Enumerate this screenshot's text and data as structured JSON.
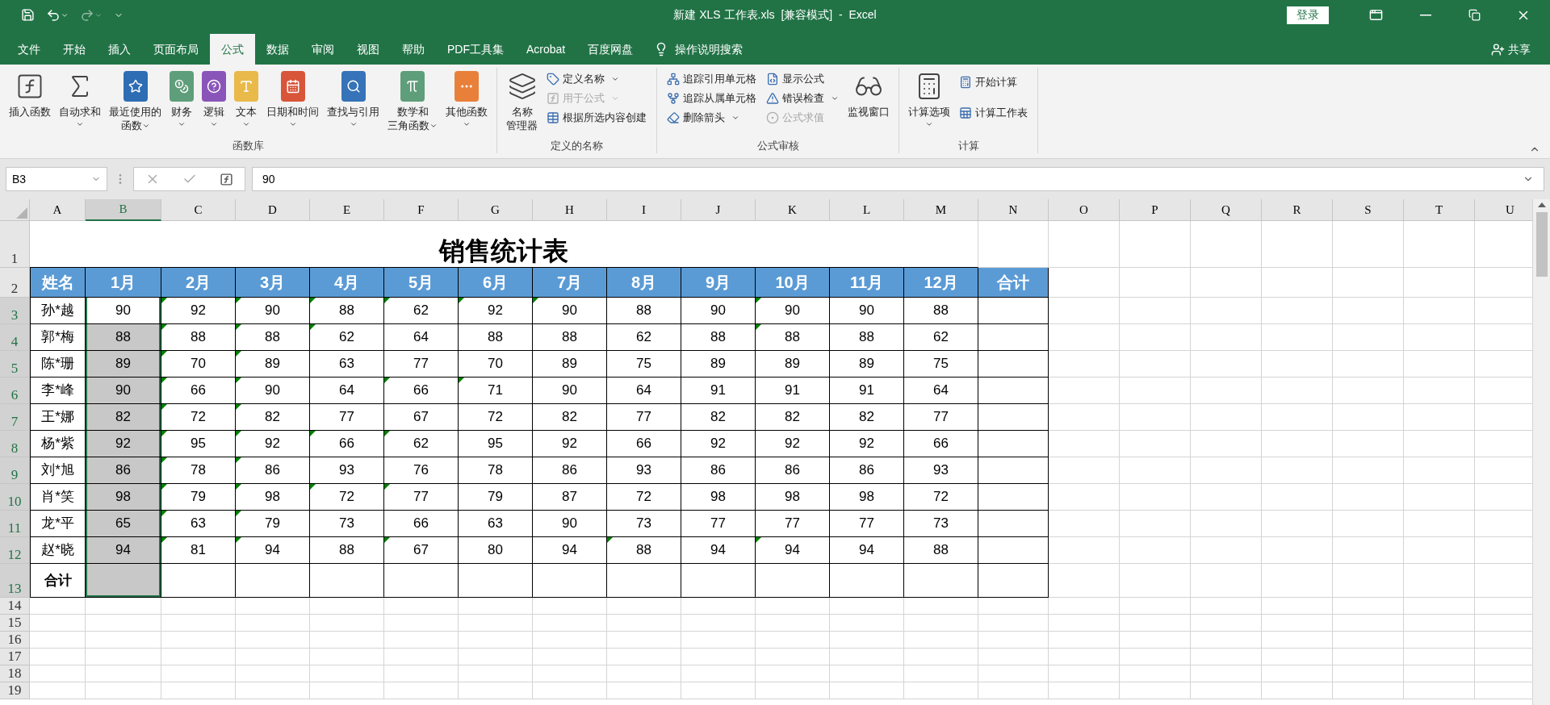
{
  "title_bar": {
    "title": "新建 XLS 工作表.xls  [兼容模式]  -  Excel",
    "sign_in": "登录"
  },
  "tabs": [
    {
      "label": "文件",
      "selected": false
    },
    {
      "label": "开始",
      "selected": false
    },
    {
      "label": "插入",
      "selected": false
    },
    {
      "label": "页面布局",
      "selected": false
    },
    {
      "label": "公式",
      "selected": true
    },
    {
      "label": "数据",
      "selected": false
    },
    {
      "label": "审阅",
      "selected": false
    },
    {
      "label": "视图",
      "selected": false
    },
    {
      "label": "帮助",
      "selected": false
    },
    {
      "label": "PDF工具集",
      "selected": false
    },
    {
      "label": "Acrobat",
      "selected": false
    },
    {
      "label": "百度网盘",
      "selected": false
    }
  ],
  "tell_me": "操作说明搜索",
  "share": "共享",
  "ribbon": [
    {
      "name": "函数库",
      "items": [
        {
          "kind": "large",
          "lines": [
            "插入函数"
          ],
          "dropdown": false,
          "disabled": false
        },
        {
          "kind": "large",
          "lines": [
            "自动求和"
          ],
          "dropdown": true,
          "disabled": false
        },
        {
          "kind": "large",
          "lines": [
            "最近使用的",
            "函数"
          ],
          "dropdown": true,
          "disabled": false
        },
        {
          "kind": "large",
          "lines": [
            "财务"
          ],
          "dropdown": true,
          "disabled": false
        },
        {
          "kind": "large",
          "lines": [
            "逻辑"
          ],
          "dropdown": true,
          "disabled": false
        },
        {
          "kind": "large",
          "lines": [
            "文本"
          ],
          "dropdown": true,
          "disabled": false
        },
        {
          "kind": "large",
          "lines": [
            "日期和时间"
          ],
          "dropdown": true,
          "disabled": false
        },
        {
          "kind": "large",
          "lines": [
            "查找与引用"
          ],
          "dropdown": true,
          "disabled": false
        },
        {
          "kind": "large",
          "lines": [
            "数学和",
            "三角函数"
          ],
          "dropdown": true,
          "disabled": false
        },
        {
          "kind": "large",
          "lines": [
            "其他函数"
          ],
          "dropdown": true,
          "disabled": false
        }
      ]
    },
    {
      "name": "定义的名称",
      "items": [
        {
          "kind": "large",
          "lines": [
            "名称",
            "管理器"
          ],
          "dropdown": false,
          "disabled": false
        },
        {
          "kind": "small",
          "lines": [
            "定义名称"
          ],
          "dropdown": true,
          "disabled": false
        },
        {
          "kind": "small",
          "lines": [
            "用于公式"
          ],
          "dropdown": true,
          "disabled": true
        },
        {
          "kind": "small",
          "lines": [
            "根据所选内容创建"
          ],
          "dropdown": false,
          "disabled": false
        }
      ]
    },
    {
      "name": "公式审核",
      "items": [
        {
          "kind": "small",
          "lines": [
            "追踪引用单元格"
          ],
          "dropdown": false,
          "disabled": false
        },
        {
          "kind": "small",
          "lines": [
            "追踪从属单元格"
          ],
          "dropdown": false,
          "disabled": false
        },
        {
          "kind": "small",
          "lines": [
            "删除箭头"
          ],
          "dropdown": true,
          "disabled": false
        },
        {
          "kind": "small",
          "lines": [
            "显示公式"
          ],
          "dropdown": false,
          "disabled": false
        },
        {
          "kind": "small",
          "lines": [
            "错误检查"
          ],
          "dropdown": true,
          "disabled": false
        },
        {
          "kind": "small",
          "lines": [
            "公式求值"
          ],
          "dropdown": false,
          "disabled": true
        },
        {
          "kind": "large",
          "lines": [
            "监视窗口"
          ],
          "dropdown": false,
          "disabled": false
        }
      ]
    },
    {
      "name": "计算",
      "items": [
        {
          "kind": "large",
          "lines": [
            "计算选项"
          ],
          "dropdown": true,
          "disabled": false
        },
        {
          "kind": "small",
          "lines": [
            "开始计算"
          ],
          "dropdown": false,
          "disabled": false
        },
        {
          "kind": "small",
          "lines": [
            "计算工作表"
          ],
          "dropdown": false,
          "disabled": false
        }
      ]
    }
  ],
  "name_box": "B3",
  "formula": "90",
  "sheet": {
    "columns": [
      {
        "label": "A",
        "selected": false
      },
      {
        "label": "B",
        "selected": true
      },
      {
        "label": "C",
        "selected": false
      },
      {
        "label": "D",
        "selected": false
      },
      {
        "label": "E",
        "selected": false
      },
      {
        "label": "F",
        "selected": false
      },
      {
        "label": "G",
        "selected": false
      },
      {
        "label": "H",
        "selected": false
      },
      {
        "label": "I",
        "selected": false
      },
      {
        "label": "J",
        "selected": false
      },
      {
        "label": "K",
        "selected": false
      },
      {
        "label": "L",
        "selected": false
      },
      {
        "label": "M",
        "selected": false
      },
      {
        "label": "N",
        "selected": false
      },
      {
        "label": "O",
        "selected": false
      },
      {
        "label": "P",
        "selected": false
      },
      {
        "label": "Q",
        "selected": false
      },
      {
        "label": "R",
        "selected": false
      },
      {
        "label": "S",
        "selected": false
      },
      {
        "label": "T",
        "selected": false
      },
      {
        "label": "U",
        "selected": false
      }
    ],
    "title_row": {
      "num": "1",
      "title": "销售统计表"
    },
    "header_row": {
      "num": "2",
      "cells": [
        "姓名",
        "1月",
        "2月",
        "3月",
        "4月",
        "5月",
        "6月",
        "7月",
        "8月",
        "9月",
        "10月",
        "11月",
        "12月",
        "合计"
      ]
    },
    "rows": [
      {
        "num": "3",
        "selected": true,
        "active": true,
        "cells": [
          "孙*越",
          "90",
          "92",
          "90",
          "88",
          "62",
          "92",
          "90",
          "88",
          "90",
          "90",
          "90",
          "88"
        ],
        "flags": [
          false,
          true,
          true,
          true,
          true,
          true,
          true,
          false,
          false,
          true,
          false,
          false
        ]
      },
      {
        "num": "4",
        "selected": true,
        "active": false,
        "cells": [
          "郭*梅",
          "88",
          "88",
          "88",
          "62",
          "64",
          "88",
          "88",
          "62",
          "88",
          "88",
          "88",
          "62"
        ],
        "flags": [
          false,
          true,
          true,
          true,
          false,
          false,
          false,
          false,
          false,
          true,
          false,
          false
        ]
      },
      {
        "num": "5",
        "selected": true,
        "active": false,
        "cells": [
          "陈*珊",
          "89",
          "70",
          "89",
          "63",
          "77",
          "70",
          "89",
          "75",
          "89",
          "89",
          "89",
          "75"
        ],
        "flags": [
          false,
          true,
          true,
          false,
          false,
          false,
          false,
          false,
          false,
          false,
          false,
          false
        ]
      },
      {
        "num": "6",
        "selected": true,
        "active": false,
        "cells": [
          "李*峰",
          "90",
          "66",
          "90",
          "64",
          "66",
          "71",
          "90",
          "64",
          "91",
          "91",
          "91",
          "64"
        ],
        "flags": [
          false,
          true,
          true,
          false,
          true,
          true,
          false,
          false,
          false,
          false,
          false,
          false
        ]
      },
      {
        "num": "7",
        "selected": true,
        "active": false,
        "cells": [
          "王*娜",
          "82",
          "72",
          "82",
          "77",
          "67",
          "72",
          "82",
          "77",
          "82",
          "82",
          "82",
          "77"
        ],
        "flags": [
          false,
          true,
          true,
          false,
          false,
          false,
          false,
          false,
          false,
          false,
          false,
          false
        ]
      },
      {
        "num": "8",
        "selected": true,
        "active": false,
        "cells": [
          "杨*紫",
          "92",
          "95",
          "92",
          "66",
          "62",
          "95",
          "92",
          "66",
          "92",
          "92",
          "92",
          "66"
        ],
        "flags": [
          false,
          true,
          true,
          true,
          true,
          false,
          false,
          false,
          false,
          false,
          false,
          false
        ]
      },
      {
        "num": "9",
        "selected": true,
        "active": false,
        "cells": [
          "刘*旭",
          "86",
          "78",
          "86",
          "93",
          "76",
          "78",
          "86",
          "93",
          "86",
          "86",
          "86",
          "93"
        ],
        "flags": [
          false,
          true,
          true,
          false,
          false,
          false,
          false,
          false,
          false,
          false,
          false,
          false
        ]
      },
      {
        "num": "10",
        "selected": true,
        "active": false,
        "cells": [
          "肖*笑",
          "98",
          "79",
          "98",
          "72",
          "77",
          "79",
          "87",
          "72",
          "98",
          "98",
          "98",
          "72"
        ],
        "flags": [
          false,
          true,
          true,
          true,
          true,
          false,
          false,
          false,
          false,
          false,
          false,
          false
        ]
      },
      {
        "num": "11",
        "selected": true,
        "active": false,
        "cells": [
          "龙*平",
          "65",
          "63",
          "79",
          "73",
          "66",
          "63",
          "90",
          "73",
          "77",
          "77",
          "77",
          "73"
        ],
        "flags": [
          false,
          true,
          true,
          false,
          false,
          false,
          false,
          false,
          false,
          false,
          false,
          false
        ]
      },
      {
        "num": "12",
        "selected": true,
        "active": false,
        "cells": [
          "赵*晓",
          "94",
          "81",
          "94",
          "88",
          "67",
          "80",
          "94",
          "88",
          "94",
          "94",
          "94",
          "88"
        ],
        "flags": [
          false,
          true,
          true,
          false,
          true,
          false,
          false,
          true,
          false,
          true,
          false,
          false
        ]
      }
    ],
    "total_row": {
      "num": "13",
      "label": "合计",
      "selected": true
    },
    "empty_rows": [
      "14",
      "15",
      "16",
      "17",
      "18",
      "19"
    ]
  }
}
